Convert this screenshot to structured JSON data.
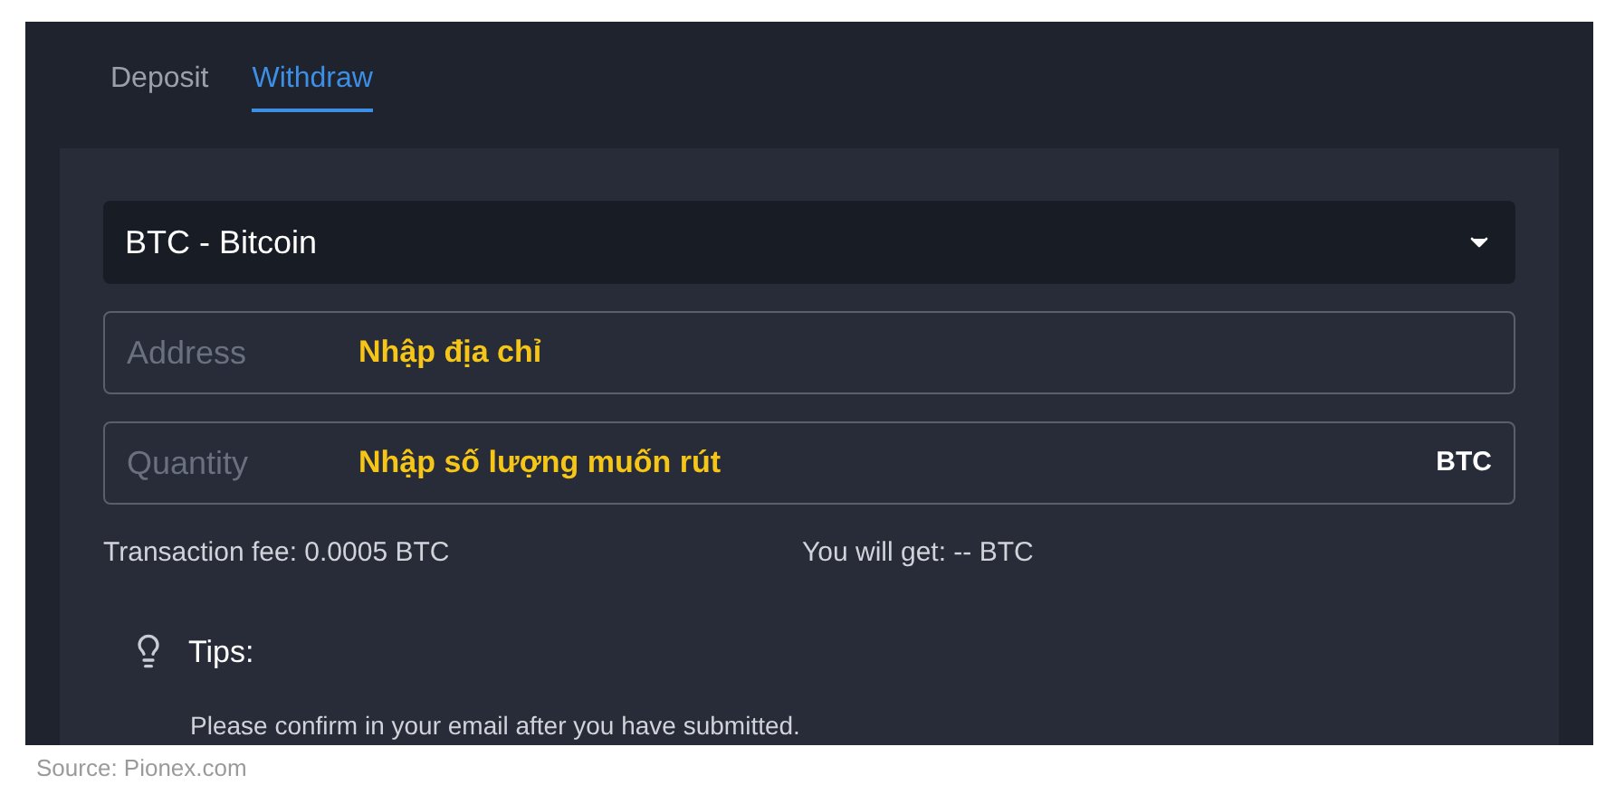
{
  "tabs": [
    {
      "label": "Deposit",
      "selected": false
    },
    {
      "label": "Withdraw",
      "selected": true
    }
  ],
  "coin_select": {
    "value": "BTC - Bitcoin"
  },
  "address": {
    "placeholder": "Address",
    "annotation": "Nhập địa chỉ"
  },
  "quantity": {
    "placeholder": "Quantity",
    "annotation": "Nhập số lượng muốn rút",
    "unit": "BTC"
  },
  "fee": "Transaction fee: 0.0005 BTC",
  "receive": "You will get: -- BTC",
  "tips": {
    "title": "Tips:",
    "text": "Please confirm in your email after you have submitted."
  },
  "caption": "Source: Pionex.com"
}
